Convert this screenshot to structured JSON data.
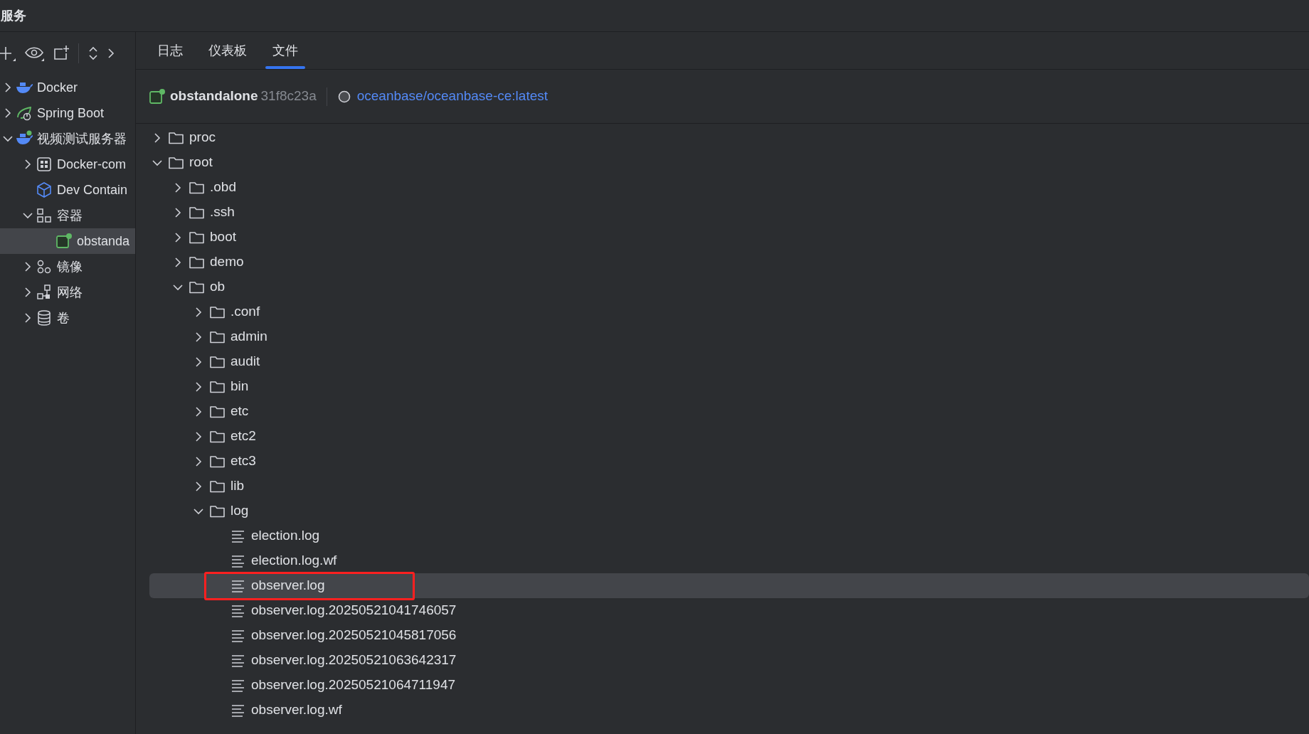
{
  "window": {
    "title": "服务"
  },
  "sidebar": {
    "items": [
      {
        "label": "Docker",
        "kind": "docker",
        "expanded": false,
        "selected": false
      },
      {
        "label": "Spring Boot",
        "kind": "spring",
        "expanded": false,
        "selected": false
      },
      {
        "label": "视频测试服务器",
        "kind": "docker-server",
        "expanded": true,
        "selected": false,
        "children": [
          {
            "label": "Docker-com",
            "kind": "compose",
            "expanded": false,
            "selected": false
          },
          {
            "label": "Dev Contain",
            "kind": "devcontainer",
            "selected": false
          },
          {
            "label": "容器",
            "kind": "containers",
            "expanded": true,
            "selected": false,
            "children": [
              {
                "label": "obstanda",
                "kind": "container",
                "selected": true
              }
            ]
          },
          {
            "label": "镜像",
            "kind": "images",
            "expanded": false,
            "selected": false
          },
          {
            "label": "网络",
            "kind": "network",
            "expanded": false,
            "selected": false
          },
          {
            "label": "卷",
            "kind": "volumes",
            "expanded": false,
            "selected": false
          }
        ]
      }
    ]
  },
  "tabs": [
    {
      "label": "日志",
      "selected": false
    },
    {
      "label": "仪表板",
      "selected": false
    },
    {
      "label": "文件",
      "selected": true
    }
  ],
  "container_header": {
    "name": "obstandalone",
    "id": "31f8c23a",
    "image": "oceanbase/oceanbase-ce:latest"
  },
  "file_tree": [
    {
      "label": "proc",
      "kind": "folder",
      "expanded": false,
      "selected": false
    },
    {
      "label": "root",
      "kind": "folder",
      "expanded": true,
      "selected": false,
      "children": [
        {
          "label": ".obd",
          "kind": "folder",
          "expanded": false,
          "selected": false
        },
        {
          "label": ".ssh",
          "kind": "folder",
          "expanded": false,
          "selected": false
        },
        {
          "label": "boot",
          "kind": "folder",
          "expanded": false,
          "selected": false
        },
        {
          "label": "demo",
          "kind": "folder",
          "expanded": false,
          "selected": false
        },
        {
          "label": "ob",
          "kind": "folder",
          "expanded": true,
          "selected": false,
          "children": [
            {
              "label": ".conf",
              "kind": "folder",
              "expanded": false,
              "selected": false
            },
            {
              "label": "admin",
              "kind": "folder",
              "expanded": false,
              "selected": false
            },
            {
              "label": "audit",
              "kind": "folder",
              "expanded": false,
              "selected": false
            },
            {
              "label": "bin",
              "kind": "folder",
              "expanded": false,
              "selected": false
            },
            {
              "label": "etc",
              "kind": "folder",
              "expanded": false,
              "selected": false
            },
            {
              "label": "etc2",
              "kind": "folder",
              "expanded": false,
              "selected": false
            },
            {
              "label": "etc3",
              "kind": "folder",
              "expanded": false,
              "selected": false
            },
            {
              "label": "lib",
              "kind": "folder",
              "expanded": false,
              "selected": false
            },
            {
              "label": "log",
              "kind": "folder",
              "expanded": true,
              "selected": false,
              "children": [
                {
                  "label": "election.log",
                  "kind": "file",
                  "selected": false,
                  "annotated": false
                },
                {
                  "label": "election.log.wf",
                  "kind": "file",
                  "selected": false,
                  "annotated": false
                },
                {
                  "label": "observer.log",
                  "kind": "file",
                  "selected": true,
                  "annotated": true
                },
                {
                  "label": "observer.log.20250521041746057",
                  "kind": "file",
                  "selected": false,
                  "annotated": false
                },
                {
                  "label": "observer.log.20250521045817056",
                  "kind": "file",
                  "selected": false,
                  "annotated": false
                },
                {
                  "label": "observer.log.20250521063642317",
                  "kind": "file",
                  "selected": false,
                  "annotated": false
                },
                {
                  "label": "observer.log.20250521064711947",
                  "kind": "file",
                  "selected": false,
                  "annotated": false
                },
                {
                  "label": "observer.log.wf",
                  "kind": "file",
                  "selected": false,
                  "annotated": false
                }
              ]
            }
          ]
        }
      ]
    }
  ]
}
